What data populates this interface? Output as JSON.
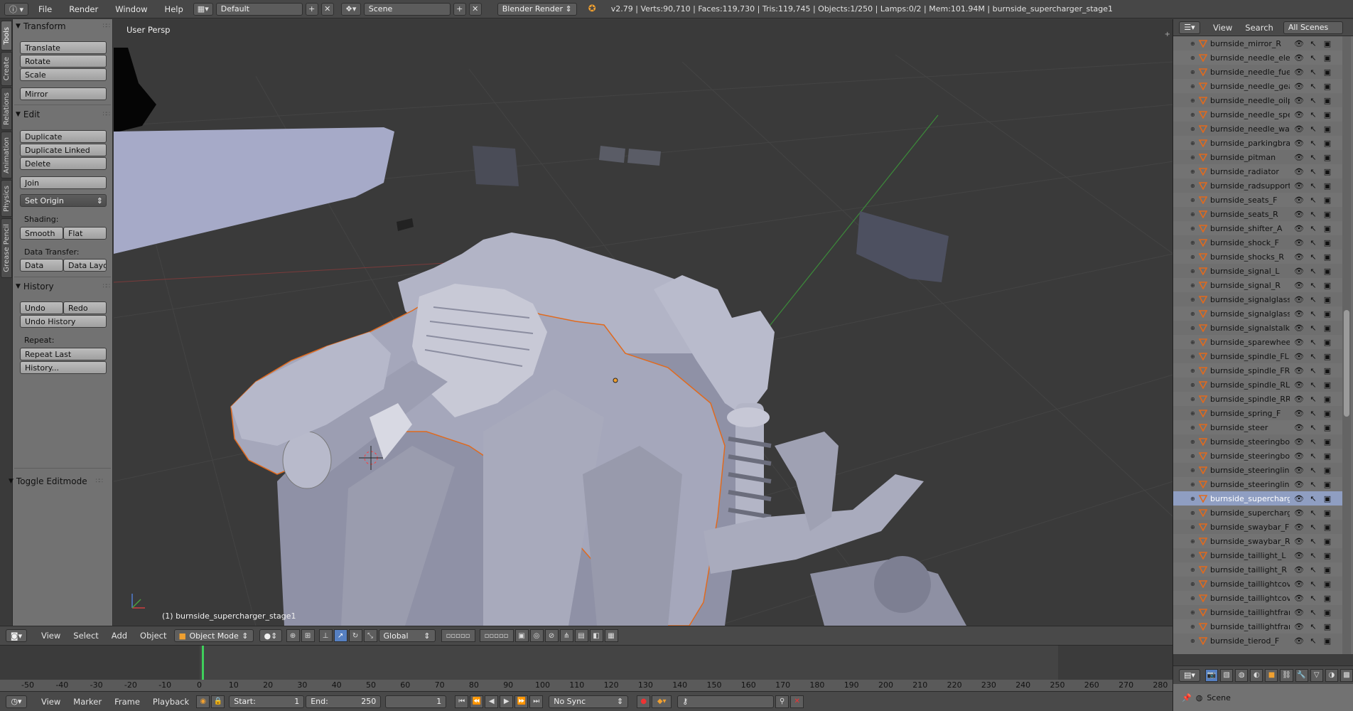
{
  "topbar": {
    "menus": [
      "File",
      "Render",
      "Window",
      "Help"
    ],
    "layout": "Default",
    "scene": "Scene",
    "engine": "Blender Render",
    "stats": "v2.79 | Verts:90,710 | Faces:119,730 | Tris:119,745 | Objects:1/250 | Lamps:0/2 | Mem:101.94M | burnside_supercharger_stage1"
  },
  "tabs": [
    "Tools",
    "Create",
    "Relations",
    "Animation",
    "Physics",
    "Grease Pencil"
  ],
  "toolshelf": {
    "transform": {
      "title": "Transform",
      "translate": "Translate",
      "rotate": "Rotate",
      "scale": "Scale",
      "mirror": "Mirror"
    },
    "edit": {
      "title": "Edit",
      "duplicate": "Duplicate",
      "duplicate_linked": "Duplicate Linked",
      "delete": "Delete",
      "join": "Join",
      "set_origin": "Set Origin",
      "shading_label": "Shading:",
      "smooth": "Smooth",
      "flat": "Flat",
      "data_transfer_label": "Data Transfer:",
      "data": "Data",
      "data_layout": "Data Layo"
    },
    "history": {
      "title": "History",
      "undo": "Undo",
      "redo": "Redo",
      "undo_history": "Undo History",
      "repeat_label": "Repeat:",
      "repeat_last": "Repeat Last",
      "history": "History..."
    },
    "toggle_editmode": "Toggle Editmode"
  },
  "viewport": {
    "label": "User Persp",
    "object_label": "(1) burnside_supercharger_stage1"
  },
  "vpheader": {
    "menus": [
      "View",
      "Select",
      "Add",
      "Object"
    ],
    "mode": "Object Mode",
    "orientation": "Global"
  },
  "timeline": {
    "ticks": [
      "-50",
      "-40",
      "-30",
      "-20",
      "-10",
      "0",
      "10",
      "20",
      "30",
      "40",
      "50",
      "60",
      "70",
      "80",
      "90",
      "100",
      "110",
      "120",
      "130",
      "140",
      "150",
      "160",
      "170",
      "180",
      "190",
      "200",
      "210",
      "220",
      "230",
      "240",
      "250",
      "260",
      "270",
      "280"
    ],
    "menus": [
      "View",
      "Marker",
      "Frame",
      "Playback"
    ],
    "start_label": "Start:",
    "start": "1",
    "end_label": "End:",
    "end": "250",
    "current": "1",
    "sync": "No Sync"
  },
  "outliner": {
    "menus": [
      "View",
      "Search"
    ],
    "filter": "All Scenes",
    "items": [
      "burnside_mirror_R",
      "burnside_needle_electr",
      "burnside_needle_fuel",
      "burnside_needle_gear",
      "burnside_needle_oilpre",
      "burnside_needle_speed",
      "burnside_needle_water",
      "burnside_parkingbrake",
      "burnside_pitman",
      "burnside_radiator",
      "burnside_radsupport",
      "burnside_seats_F",
      "burnside_seats_R",
      "burnside_shifter_A",
      "burnside_shock_F",
      "burnside_shocks_R",
      "burnside_signal_L",
      "burnside_signal_R",
      "burnside_signalglass_L",
      "burnside_signalglass_R",
      "burnside_signalstalk",
      "burnside_sparewheel",
      "burnside_spindle_FL",
      "burnside_spindle_FR",
      "burnside_spindle_RL",
      "burnside_spindle_RR",
      "burnside_spring_F",
      "burnside_steer",
      "burnside_steeringbox",
      "burnside_steeringbox_",
      "burnside_steeringlink_",
      "burnside_steeringlink_",
      "burnside_supercharger",
      "burnside_supercharger",
      "burnside_swaybar_F",
      "burnside_swaybar_R",
      "burnside_taillight_L",
      "burnside_taillight_R",
      "burnside_taillightcover",
      "burnside_taillightcover",
      "burnside_taillightframe",
      "burnside_taillightframe",
      "burnside_tierod_F"
    ],
    "selected_index": 32
  },
  "properties": {
    "scene": "Scene"
  },
  "colors": {
    "selection_outline": "#e06a1e",
    "playhead": "#3fcf5b",
    "active_blue": "#5680c2"
  }
}
